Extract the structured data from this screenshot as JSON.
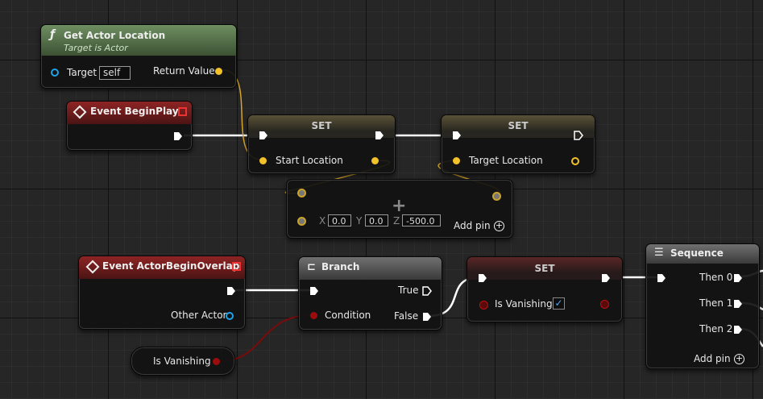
{
  "get_actor_location": {
    "title": "Get Actor Location",
    "subtitle": "Target is Actor",
    "target_label": "Target",
    "target_value": "self",
    "return_label": "Return Value",
    "func_icon": "ƒ"
  },
  "event_begin_play": {
    "title": "Event BeginPlay"
  },
  "set1": {
    "title": "SET",
    "pin_label": "Start Location"
  },
  "set2": {
    "title": "SET",
    "pin_label": "Target Location"
  },
  "make_vector": {
    "x_label": "X",
    "x_value": "0.0",
    "y_label": "Y",
    "y_value": "0.0",
    "z_label": "Z",
    "z_value": "-500.0",
    "add_pin": "Add pin",
    "plus": "+"
  },
  "event_overlap": {
    "title": "Event ActorBeginOverlap",
    "other_actor": "Other Actor"
  },
  "branch": {
    "title": "Branch",
    "true_label": "True",
    "false_label": "False",
    "condition_label": "Condition"
  },
  "set3": {
    "title": "SET",
    "pin_label": "Is Vanishing",
    "check": "✓"
  },
  "sequence": {
    "title": "Sequence",
    "then0": "Then 0",
    "then1": "Then 1",
    "then2": "Then 2",
    "add_pin": "Add pin"
  },
  "is_vanishing_getter": {
    "label": "Is Vanishing"
  },
  "colors": {
    "exec": "#ffffff",
    "vector": "#f3c229",
    "object": "#1ea2e8",
    "boolean": "#9b0d0d"
  }
}
